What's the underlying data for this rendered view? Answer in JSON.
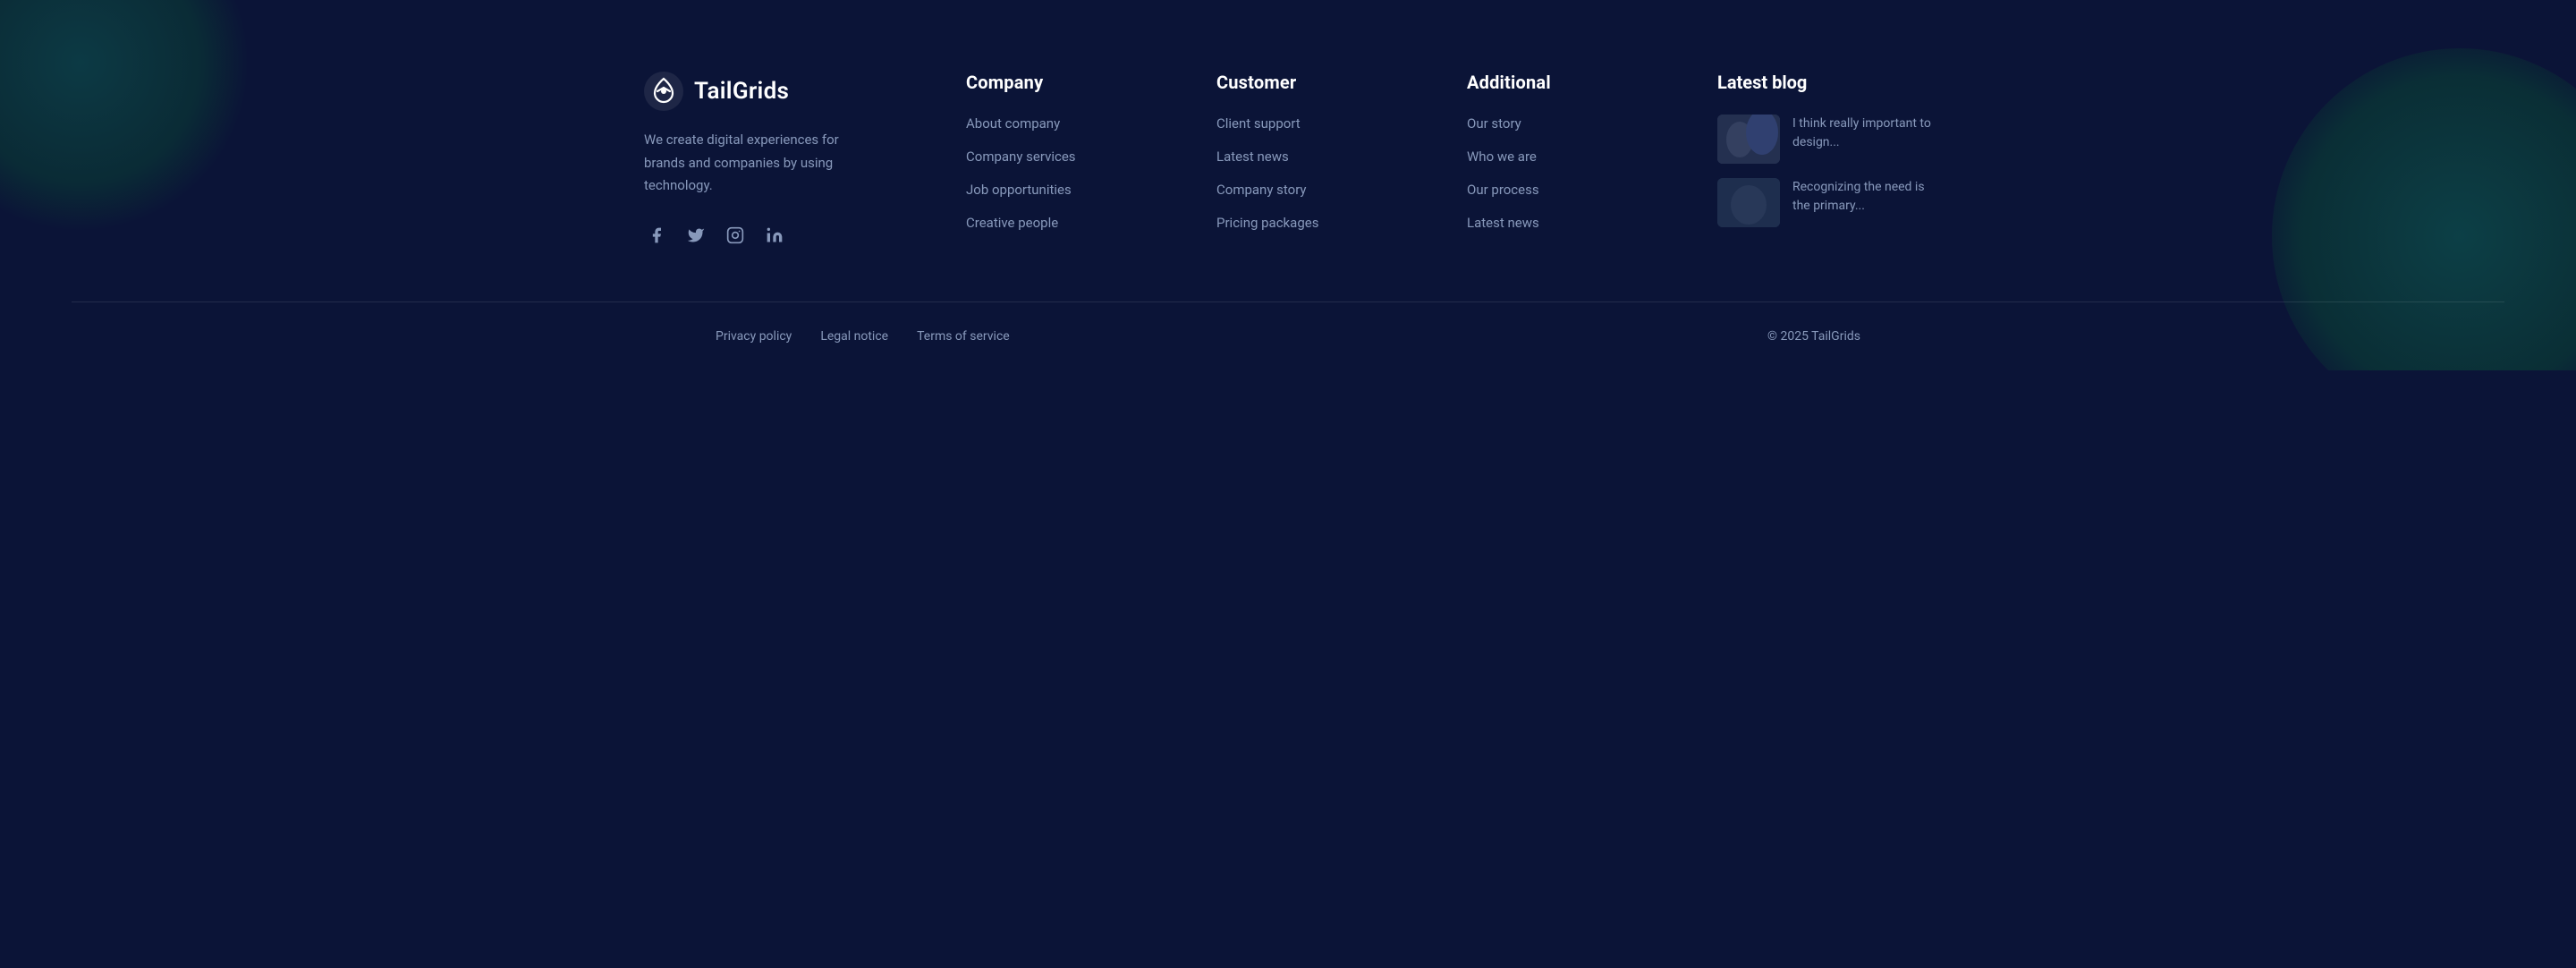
{
  "brand": {
    "logo_text": "TailGrids",
    "description": "We create digital experiences for brands and companies by using technology.",
    "social": {
      "facebook_label": "Facebook",
      "twitter_label": "Twitter",
      "instagram_label": "Instagram",
      "linkedin_label": "LinkedIn"
    }
  },
  "columns": {
    "company": {
      "title": "Company",
      "links": [
        {
          "label": "About company"
        },
        {
          "label": "Company services"
        },
        {
          "label": "Job opportunities"
        },
        {
          "label": "Creative people"
        }
      ]
    },
    "customer": {
      "title": "Customer",
      "links": [
        {
          "label": "Client support"
        },
        {
          "label": "Latest news"
        },
        {
          "label": "Company story"
        },
        {
          "label": "Pricing packages"
        }
      ]
    },
    "additional": {
      "title": "Additional",
      "links": [
        {
          "label": "Our story"
        },
        {
          "label": "Who we are"
        },
        {
          "label": "Our process"
        },
        {
          "label": "Latest news"
        }
      ]
    },
    "blog": {
      "title": "Latest blog",
      "posts": [
        {
          "text": "I think really important to design..."
        },
        {
          "text": "Recognizing the need is the primary..."
        }
      ]
    }
  },
  "footer": {
    "links": [
      {
        "label": "Privacy policy"
      },
      {
        "label": "Legal notice"
      },
      {
        "label": "Terms of service"
      }
    ],
    "copyright": "© 2025 TailGrids"
  }
}
